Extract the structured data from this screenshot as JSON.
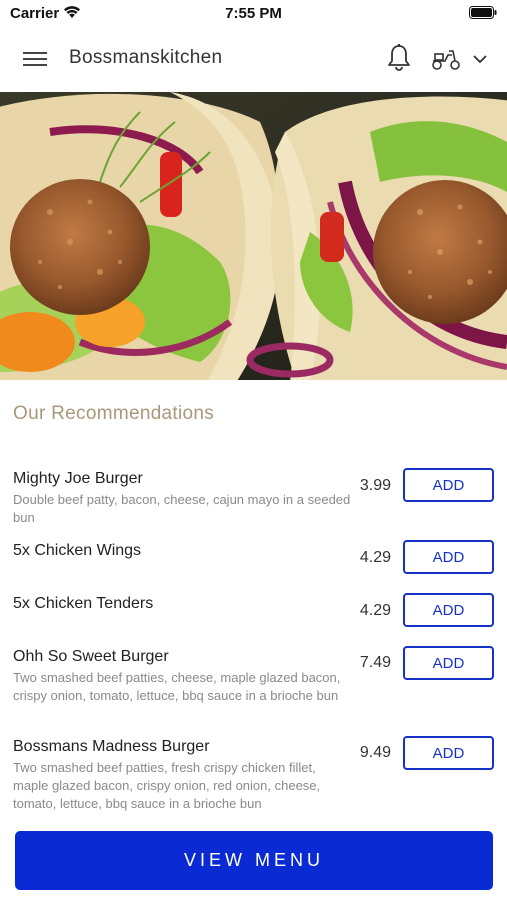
{
  "status_bar": {
    "carrier": "Carrier",
    "time": "7:55 PM",
    "icons": [
      "wifi-icon",
      "battery-icon"
    ]
  },
  "header": {
    "title": "Bossmanskitchen",
    "icons": [
      "menu-icon",
      "bell-icon",
      "scooter-icon",
      "chevron-down-icon"
    ]
  },
  "hero": {
    "image": "falafel wraps"
  },
  "recommendations": {
    "title": "Our Recommendations",
    "add_label": "ADD",
    "items": [
      {
        "name": "Mighty Joe Burger",
        "description": "Double beef patty, bacon, cheese, cajun mayo in a seeded bun",
        "price": "3.99"
      },
      {
        "name": "5x Chicken Wings",
        "description": "",
        "price": "4.29"
      },
      {
        "name": "5x Chicken Tenders",
        "description": "",
        "price": "4.29"
      },
      {
        "name": "Ohh So Sweet Burger",
        "description": "Two smashed beef patties, cheese, maple glazed bacon, crispy onion, tomato, lettuce, bbq sauce in a brioche bun",
        "price": "7.49"
      },
      {
        "name": "Bossmans Madness Burger",
        "description": "Two smashed beef patties, fresh crispy chicken fillet, maple glazed bacon, crispy onion, red onion, cheese, tomato, lettuce, bbq sauce in a brioche bun",
        "price": "9.49"
      }
    ]
  },
  "footer": {
    "view_menu_label": "VIEW MENU"
  },
  "colors": {
    "primary": "#0a2bd4",
    "accent_text": "#a8987a",
    "button_border": "#1531c8"
  }
}
